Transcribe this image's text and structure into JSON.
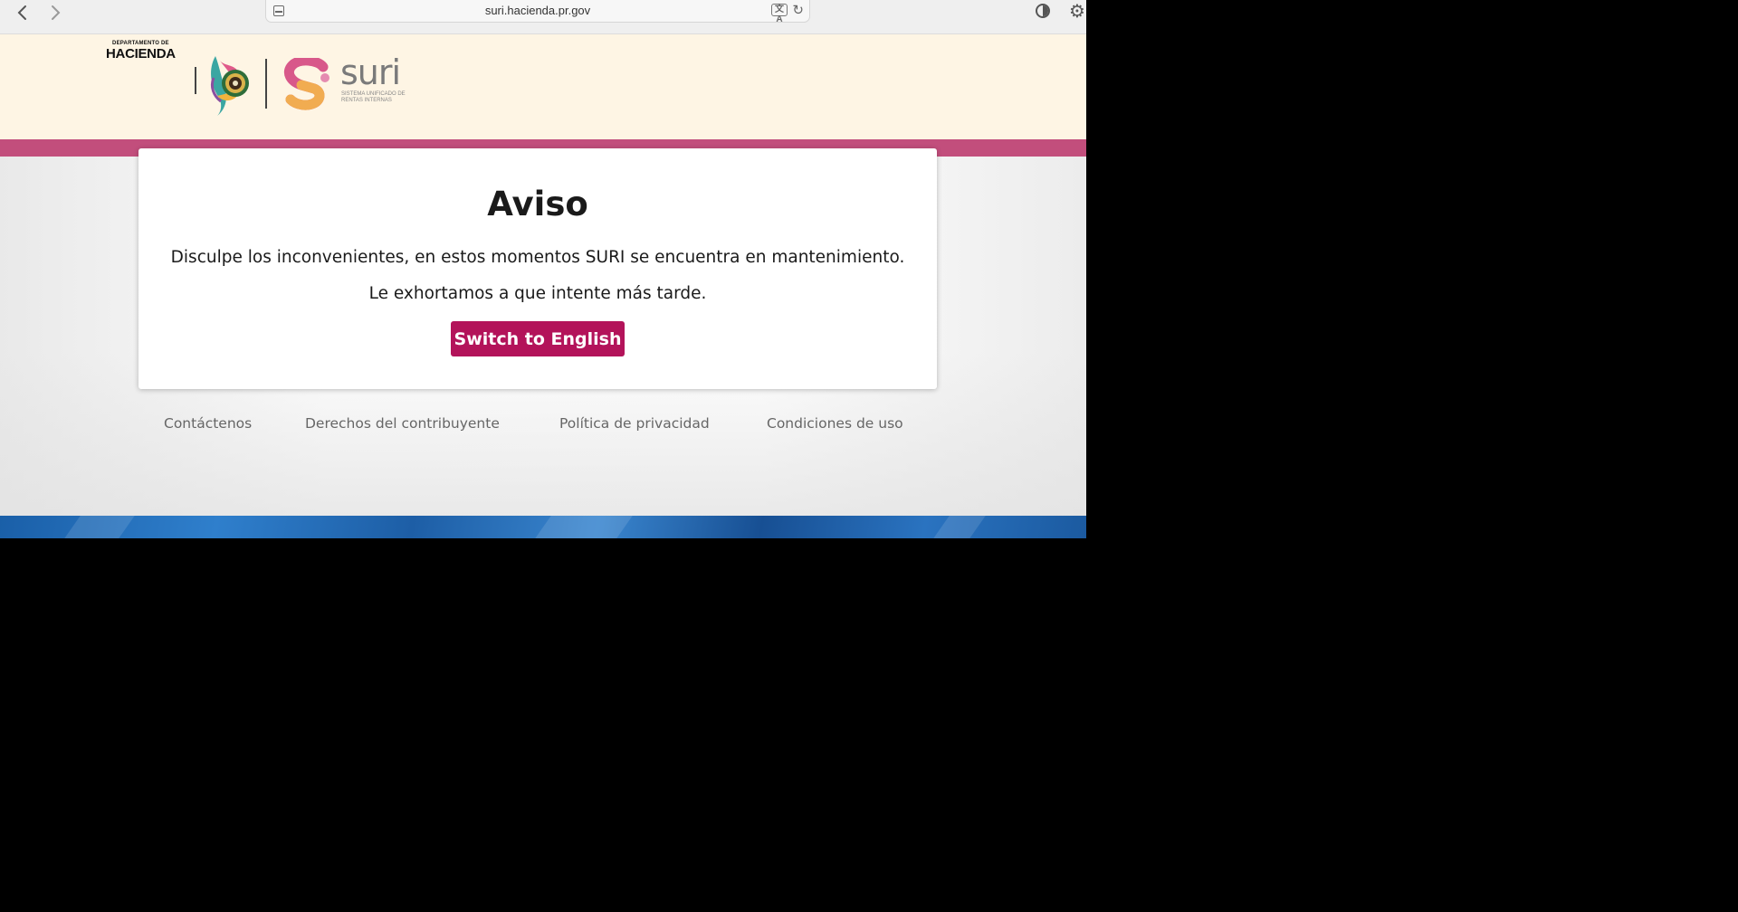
{
  "browser": {
    "back_icon": "chevron-left-icon",
    "forward_icon": "chevron-right-icon",
    "url": "suri.hacienda.pr.gov",
    "translate_icon": "translate-icon",
    "reload_icon": "reload-icon",
    "sidebar_icon": "sidebar-toggle-icon",
    "settings_icon": "gear-icon"
  },
  "header": {
    "hacienda_small": "DEPARTAMENTO DE",
    "hacienda_big": "HACIENDA",
    "suri_word": "suri",
    "suri_subtitle": "SISTEMA UNIFICADO DE RENTAS INTERNAS"
  },
  "notice": {
    "title": "Aviso",
    "message_1": "Disculpe los inconvenientes, en estos momentos SURI se encuentra en mantenimiento.",
    "message_2": "Le exhortamos a que intente más tarde.",
    "switch_label": "Switch to English"
  },
  "footer": {
    "links": [
      "Contáctenos",
      "Derechos del contribuyente",
      "Política de privacidad",
      "Condiciones de uso"
    ]
  },
  "colors": {
    "header_bg": "#fef5e4",
    "pink_band": "#c24e7c",
    "button_bg": "#b3135a",
    "blue_band": "#1d5ea6"
  }
}
